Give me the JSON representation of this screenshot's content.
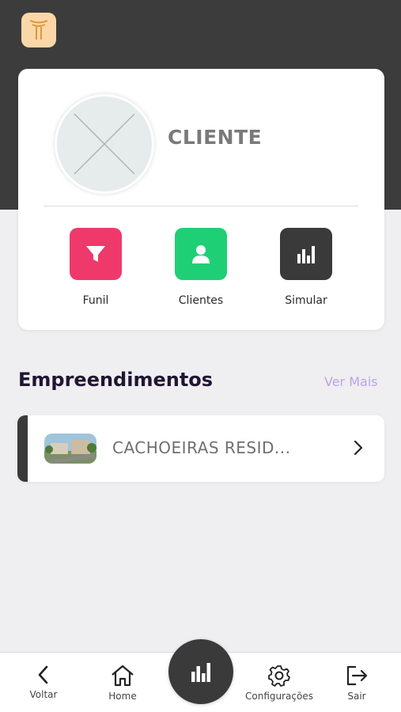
{
  "header": {
    "logo_icon": "brand-logo-icon",
    "logo_bg": "#fbd7a8"
  },
  "profile": {
    "name": "CLIENTE",
    "avatar_icon": "placeholder-image-icon",
    "actions": [
      {
        "label": "Funil",
        "icon": "filter-icon",
        "color": "#f0396b"
      },
      {
        "label": "Clientes",
        "icon": "user-icon",
        "color": "#1fcf75"
      },
      {
        "label": "Simular",
        "icon": "bar-chart-icon",
        "color": "#3a3a3a"
      }
    ]
  },
  "developments": {
    "title": "Empreendimentos",
    "see_more": "Ver Mais",
    "items": [
      {
        "name": "CACHOEIRAS RESID...",
        "thumb_icon": "building-photo-icon"
      }
    ]
  },
  "bottom_nav": {
    "items": [
      {
        "label": "Voltar",
        "icon": "chevron-left-icon"
      },
      {
        "label": "Home",
        "icon": "home-icon"
      },
      {
        "label": "Configurações",
        "icon": "gear-icon"
      },
      {
        "label": "Sair",
        "icon": "logout-icon"
      }
    ],
    "center_icon": "bar-chart-icon"
  },
  "colors": {
    "header_bg": "#3c3c3c",
    "accent_link": "#b9a4e6",
    "title": "#1f1633"
  }
}
